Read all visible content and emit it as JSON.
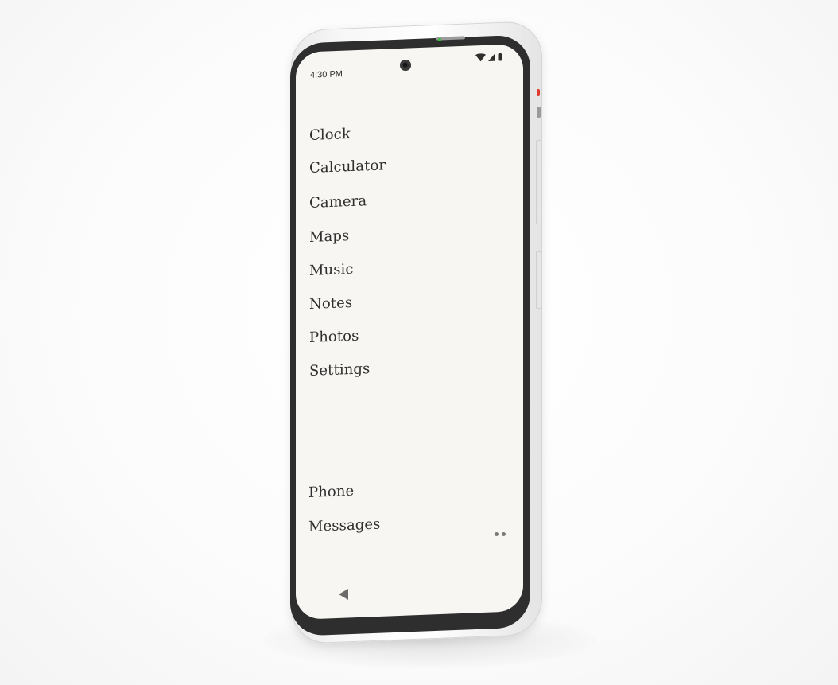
{
  "status_bar": {
    "time": "4:30 PM",
    "icons": [
      "wifi-icon",
      "signal-icon",
      "battery-icon"
    ]
  },
  "launcher": {
    "apps": [
      {
        "label": "Clock"
      },
      {
        "label": "Calculator"
      },
      {
        "label": "Camera"
      },
      {
        "label": "Maps"
      },
      {
        "label": "Music"
      },
      {
        "label": "Notes"
      },
      {
        "label": "Photos"
      },
      {
        "label": "Settings"
      }
    ],
    "dock": [
      {
        "label": "Phone"
      },
      {
        "label": "Messages"
      }
    ],
    "page_indicator": {
      "pages": 2
    }
  },
  "navigation": {
    "back_icon": "back-triangle-icon"
  },
  "colors": {
    "screen_bg": "#f7f6f3",
    "text": "#2f2f2f",
    "bezel": "#2e2e2e",
    "status_led": "#33c23a",
    "side_accent": "#e03a2f"
  }
}
